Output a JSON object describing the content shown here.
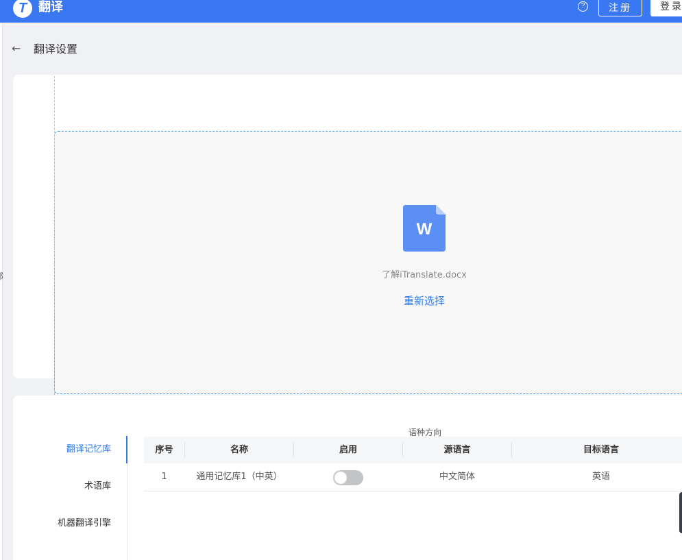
{
  "header": {
    "logo_letter": "T",
    "app_title": "翻译",
    "help_symbol": "?",
    "register_label": "注册",
    "login_label": "登录"
  },
  "page_edge_glyph": "部",
  "breadcrumb": {
    "back_symbol": "←",
    "title": "翻译设置"
  },
  "upload": {
    "file_icon_letter": "W",
    "file_name": "了解iTranslate.docx",
    "reselect_label": "重新选择"
  },
  "settings": {
    "direction_label": "语种方向",
    "tabs": [
      {
        "label": "翻译记忆库",
        "active": true
      },
      {
        "label": "术语库",
        "active": false
      },
      {
        "label": "机器翻译引擎",
        "active": false
      }
    ],
    "table": {
      "columns": [
        "序号",
        "名称",
        "启用",
        "源语言",
        "目标语言"
      ],
      "rows": [
        {
          "index": "1",
          "name": "通用记忆库1（中英）",
          "enabled": false,
          "source": "中文简体",
          "target": "英语"
        }
      ]
    }
  },
  "colors": {
    "brand": "#3a78f2",
    "link": "#2f7ae8",
    "toggle_off": "#c3c4c7"
  },
  "icons": {
    "logo": "logo-t-icon",
    "help": "question-circle-icon",
    "back": "arrow-left-icon",
    "file": "word-document-icon"
  }
}
